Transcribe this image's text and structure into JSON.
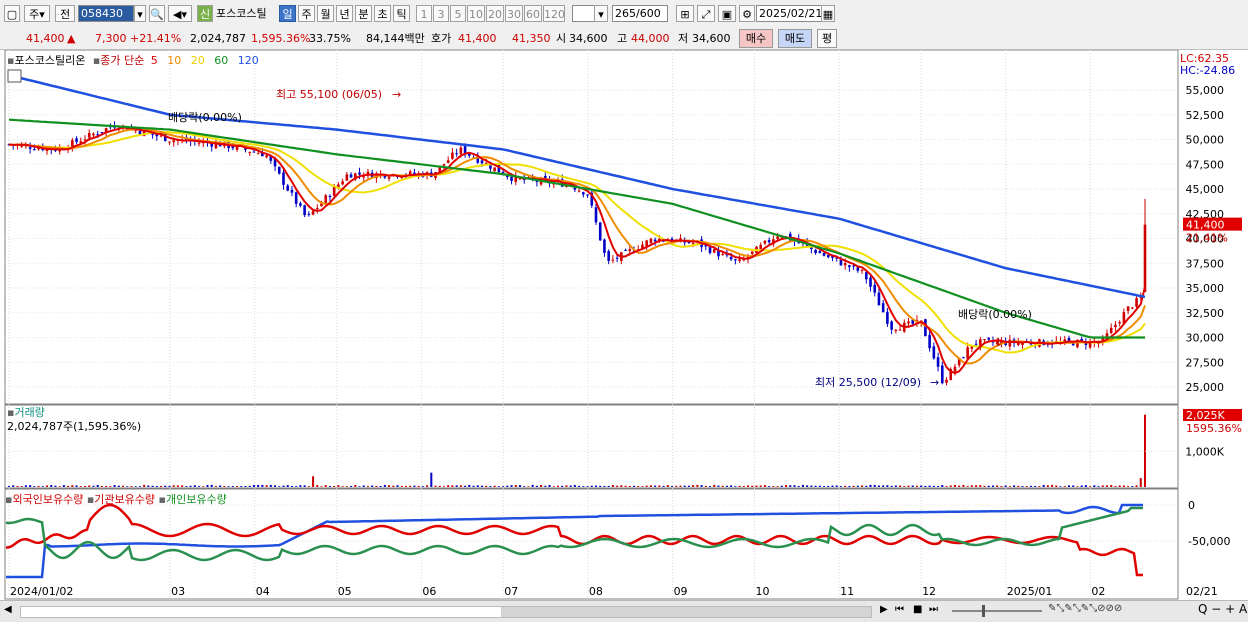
{
  "toolbar": {
    "market_label": "주",
    "prev_label": "전",
    "code": "058430",
    "shin": "신",
    "stock_name": "포스코스틸",
    "periods": [
      "일",
      "주",
      "월",
      "년",
      "분",
      "초",
      "틱"
    ],
    "active_period": "일",
    "intervals": [
      "1",
      "3",
      "5",
      "10",
      "20",
      "30",
      "60",
      "120"
    ],
    "count": "265",
    "total": "/600",
    "date": "2025/02/21"
  },
  "quote": {
    "price": "41,400",
    "arrow": "▲",
    "change": "7,300",
    "change_pct": "+21.41%",
    "volume": "2,024,787",
    "vol_ratio": "1,595.36%",
    "turnover": "33.75%",
    "amount": "84,144백만",
    "hoga_label": "호가",
    "ask": "41,400",
    "bid": "41,350",
    "open_label": "시",
    "open": "34,600",
    "high_label": "고",
    "high": "44,000",
    "low_label": "저",
    "low": "34,600",
    "buy_label": "매수",
    "sell_label": "매도",
    "eval_label": "평"
  },
  "price_panel": {
    "stock_name": "포스코스틸리온",
    "ma_label": "종가 단순",
    "ma_periods": [
      "5",
      "10",
      "20",
      "60",
      "120"
    ],
    "lc": "LC:62.35",
    "hc": "HC:-24.86",
    "current_tag": "41,400",
    "current_pct": "21.41%",
    "high_annotation": "최고 55,100 (06/05)",
    "low_annotation": "최저 25,500 (12/09)",
    "dividend_1": "배당락(0.00%)",
    "dividend_2": "배당락(0.00%)"
  },
  "volume_panel": {
    "title": "거래량",
    "value": "2,024,787주(1,595.36%)",
    "tag": "2,025K",
    "tag_pct": "1595.36%",
    "axis_label": "1,000K"
  },
  "holding_panel": {
    "series_labels": [
      "외국인보유수량",
      "기관보유수량",
      "개인보유수량"
    ],
    "axis_labels": [
      "0",
      "-50,000"
    ]
  },
  "x_axis": [
    "2024/01/02",
    "03",
    "04",
    "05",
    "06",
    "07",
    "08",
    "09",
    "10",
    "11",
    "12",
    "2025/01",
    "02"
  ],
  "x_axis_right": "02/21",
  "colors": {
    "up": "#d00000",
    "down": "#0000c8",
    "ma5": "#e00000",
    "ma10": "#f08c00",
    "ma20": "#f0e000",
    "ma60": "#109020",
    "ma120": "#2050e0"
  },
  "chart_data": {
    "type": "candlestick",
    "y_axis_ticks": [
      55000,
      52500,
      50000,
      47500,
      45000,
      42500,
      40000,
      37500,
      35000,
      32500,
      30000,
      27500,
      25000
    ],
    "ylim": [
      24000,
      57500
    ],
    "months": [
      "2024/01",
      "2024/02",
      "2024/03",
      "2024/04",
      "2024/05",
      "2024/06",
      "2024/07",
      "2024/08",
      "2024/09",
      "2024/10",
      "2024/11",
      "2024/12",
      "2025/01",
      "2025/02"
    ],
    "close_trend": [
      {
        "date": "2024/01/02",
        "close": 49500
      },
      {
        "date": "2024/01/20",
        "close": 49000
      },
      {
        "date": "2024/02/10",
        "close": 51500
      },
      {
        "date": "2024/03/01",
        "close": 50000
      },
      {
        "date": "2024/03/20",
        "close": 49500
      },
      {
        "date": "2024/04/05",
        "close": 48500
      },
      {
        "date": "2024/04/20",
        "close": 42000
      },
      {
        "date": "2024/05/05",
        "close": 46500
      },
      {
        "date": "2024/05/25",
        "close": 46500
      },
      {
        "date": "2024/06/05",
        "close": 46500
      },
      {
        "date": "2024/06/15",
        "close": 49000
      },
      {
        "date": "2024/07/05",
        "close": 46000
      },
      {
        "date": "2024/07/25",
        "close": 45500
      },
      {
        "date": "2024/08/01",
        "close": 44500
      },
      {
        "date": "2024/08/08",
        "close": 37500
      },
      {
        "date": "2024/08/25",
        "close": 40000
      },
      {
        "date": "2024/09/10",
        "close": 39500
      },
      {
        "date": "2024/09/25",
        "close": 37500
      },
      {
        "date": "2024/10/10",
        "close": 40500
      },
      {
        "date": "2024/10/25",
        "close": 38500
      },
      {
        "date": "2024/11/10",
        "close": 36500
      },
      {
        "date": "2024/11/20",
        "close": 31000
      },
      {
        "date": "2024/12/01",
        "close": 31500
      },
      {
        "date": "2024/12/09",
        "close": 25500
      },
      {
        "date": "2024/12/20",
        "close": 29500
      },
      {
        "date": "2025/01/10",
        "close": 29500
      },
      {
        "date": "2025/02/05",
        "close": 29500
      },
      {
        "date": "2025/02/15",
        "close": 33000
      },
      {
        "date": "2025/02/20",
        "close": 34100
      },
      {
        "date": "2025/02/21",
        "close": 41400
      }
    ],
    "ma120_trend": [
      {
        "date": "2024/01/02",
        "value": 56500
      },
      {
        "date": "2024/03/01",
        "value": 52500
      },
      {
        "date": "2024/05/01",
        "value": 51000
      },
      {
        "date": "2024/07/01",
        "value": 49000
      },
      {
        "date": "2024/09/01",
        "value": 45000
      },
      {
        "date": "2024/11/01",
        "value": 42000
      },
      {
        "date": "2025/01/01",
        "value": 37000
      },
      {
        "date": "2025/02/21",
        "value": 34100
      }
    ],
    "ma60_trend": [
      {
        "date": "2024/01/02",
        "value": 52000
      },
      {
        "date": "2024/03/01",
        "value": 51000
      },
      {
        "date": "2024/05/01",
        "value": 48500
      },
      {
        "date": "2024/07/01",
        "value": 46500
      },
      {
        "date": "2024/09/01",
        "value": 43500
      },
      {
        "date": "2024/11/01",
        "value": 38500
      },
      {
        "date": "2025/01/01",
        "value": 32500
      },
      {
        "date": "2025/02/01",
        "value": 30000
      },
      {
        "date": "2025/02/21",
        "value": 30000
      }
    ],
    "volume_peaks": [
      {
        "date": "2024/04/22",
        "volume": 300000
      },
      {
        "date": "2024/06/05",
        "volume": 400000
      },
      {
        "date": "2025/02/20",
        "volume": 250000
      },
      {
        "date": "2025/02/21",
        "volume": 2024787
      }
    ]
  }
}
